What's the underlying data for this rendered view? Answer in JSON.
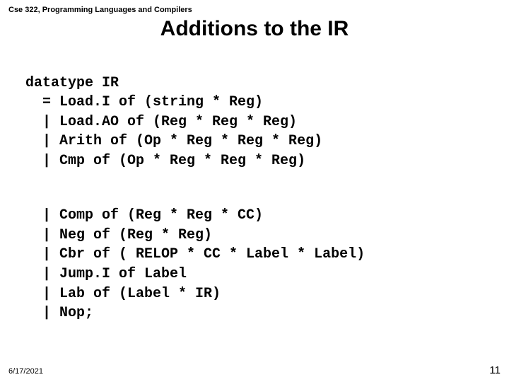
{
  "course_label": "Cse 322, Programming Languages and Compilers",
  "title": "Additions to the IR",
  "code": {
    "l0": "datatype IR",
    "l1": "  = Load.I of (string * Reg)",
    "l2": "  | Load.AO of (Reg * Reg * Reg)",
    "l3": "  | Arith of (Op * Reg * Reg * Reg)",
    "l4": "  | Cmp of (Op * Reg * Reg * Reg)",
    "l5": "  | Comp of (Reg * Reg * CC)",
    "l6": "  | Neg of (Reg * Reg)",
    "l7": "  | Cbr of ( RELOP * CC * Label * Label)",
    "l8": "  | Jump.I of Label",
    "l9": "  | Lab of (Label * IR)",
    "l10": "  | Nop;"
  },
  "footer": {
    "date": "6/17/2021",
    "pageno": "11"
  }
}
